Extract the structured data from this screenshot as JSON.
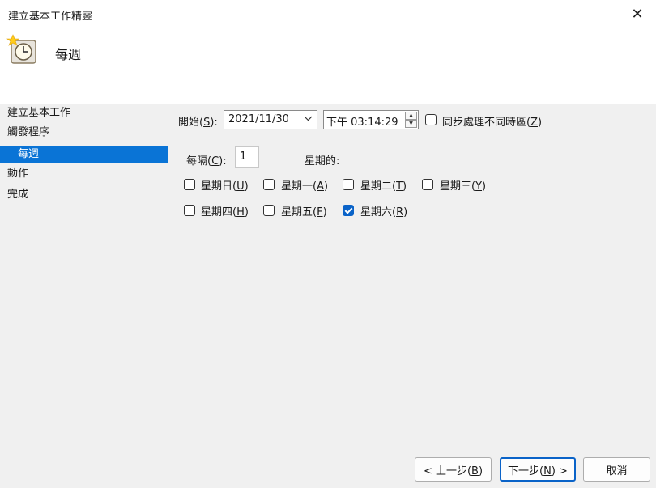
{
  "window": {
    "title": "建立基本工作精靈",
    "close_glyph": "✕"
  },
  "header": {
    "title": "每週",
    "icon": "clock-icon"
  },
  "nav": {
    "items": [
      {
        "label": "建立基本工作"
      },
      {
        "label": "觸發程序"
      },
      {
        "label": "每週",
        "selected": true
      },
      {
        "label": "動作"
      },
      {
        "label": "完成"
      }
    ]
  },
  "start": {
    "label_pre": "開始(",
    "label_key": "S",
    "label_post": "):",
    "date_value": "2021/11/30",
    "time_value": "下午 03:14:29",
    "sync_pre": "同步處理不同時區(",
    "sync_key": "Z",
    "sync_post": ")"
  },
  "recur": {
    "label_pre": "每隔(",
    "label_key": "C",
    "label_post": "):",
    "value": "1",
    "unit": "星期的:"
  },
  "days": [
    {
      "pre": "星期日(",
      "key": "U",
      "post": ")",
      "checked": false
    },
    {
      "pre": "星期一(",
      "key": "A",
      "post": ")",
      "checked": false
    },
    {
      "pre": "星期二(",
      "key": "T",
      "post": ")",
      "checked": false
    },
    {
      "pre": "星期三(",
      "key": "Y",
      "post": ")",
      "checked": false
    },
    {
      "pre": "星期四(",
      "key": "H",
      "post": ")",
      "checked": false
    },
    {
      "pre": "星期五(",
      "key": "F",
      "post": ")",
      "checked": false
    },
    {
      "pre": "星期六(",
      "key": "R",
      "post": ")",
      "checked": true
    }
  ],
  "buttons": {
    "back_pre": "< 上一步(",
    "back_key": "B",
    "back_post": ")",
    "next_pre": "下一步(",
    "next_key": "N",
    "next_post": ") >",
    "cancel": "取消"
  }
}
